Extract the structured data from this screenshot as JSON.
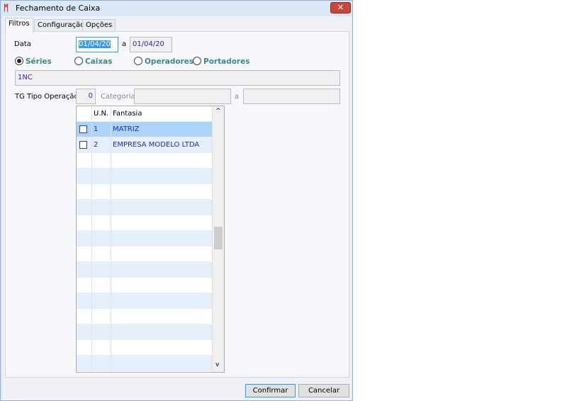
{
  "window": {
    "title": "Fechamento de Caixa",
    "close_icon": "close-icon",
    "accent": "#3399ff"
  },
  "tabs": [
    {
      "label": "Filtros",
      "active": true
    },
    {
      "label": "Configuração"
    },
    {
      "label": "Opções"
    }
  ],
  "filters": {
    "data_label": "Data",
    "date_from": "01/04/20",
    "date_sep": "a",
    "date_to": "01/04/20",
    "radios": [
      {
        "label": "Séries",
        "checked": true
      },
      {
        "label": "Caixas"
      },
      {
        "label": "Operadores"
      },
      {
        "label": "Portadores"
      }
    ],
    "series_value": "1NC",
    "tg_label": "TG Tipo Operação",
    "tg_value": "0",
    "categoria_label": "Categoria",
    "categoria_from": "",
    "categoria_sep": "a",
    "categoria_to": ""
  },
  "grid": {
    "columns": [
      "",
      "U.N.",
      "Fantasia"
    ],
    "rows": [
      {
        "checked": false,
        "un": "1",
        "fantasia": "MATRIZ"
      },
      {
        "checked": false,
        "un": "2",
        "fantasia": "EMPRESA MODELO LTDA"
      }
    ],
    "scroll_up": "^",
    "scroll_down": "v"
  },
  "buttons": {
    "confirm": "Confirmar",
    "cancel": "Cancelar"
  }
}
